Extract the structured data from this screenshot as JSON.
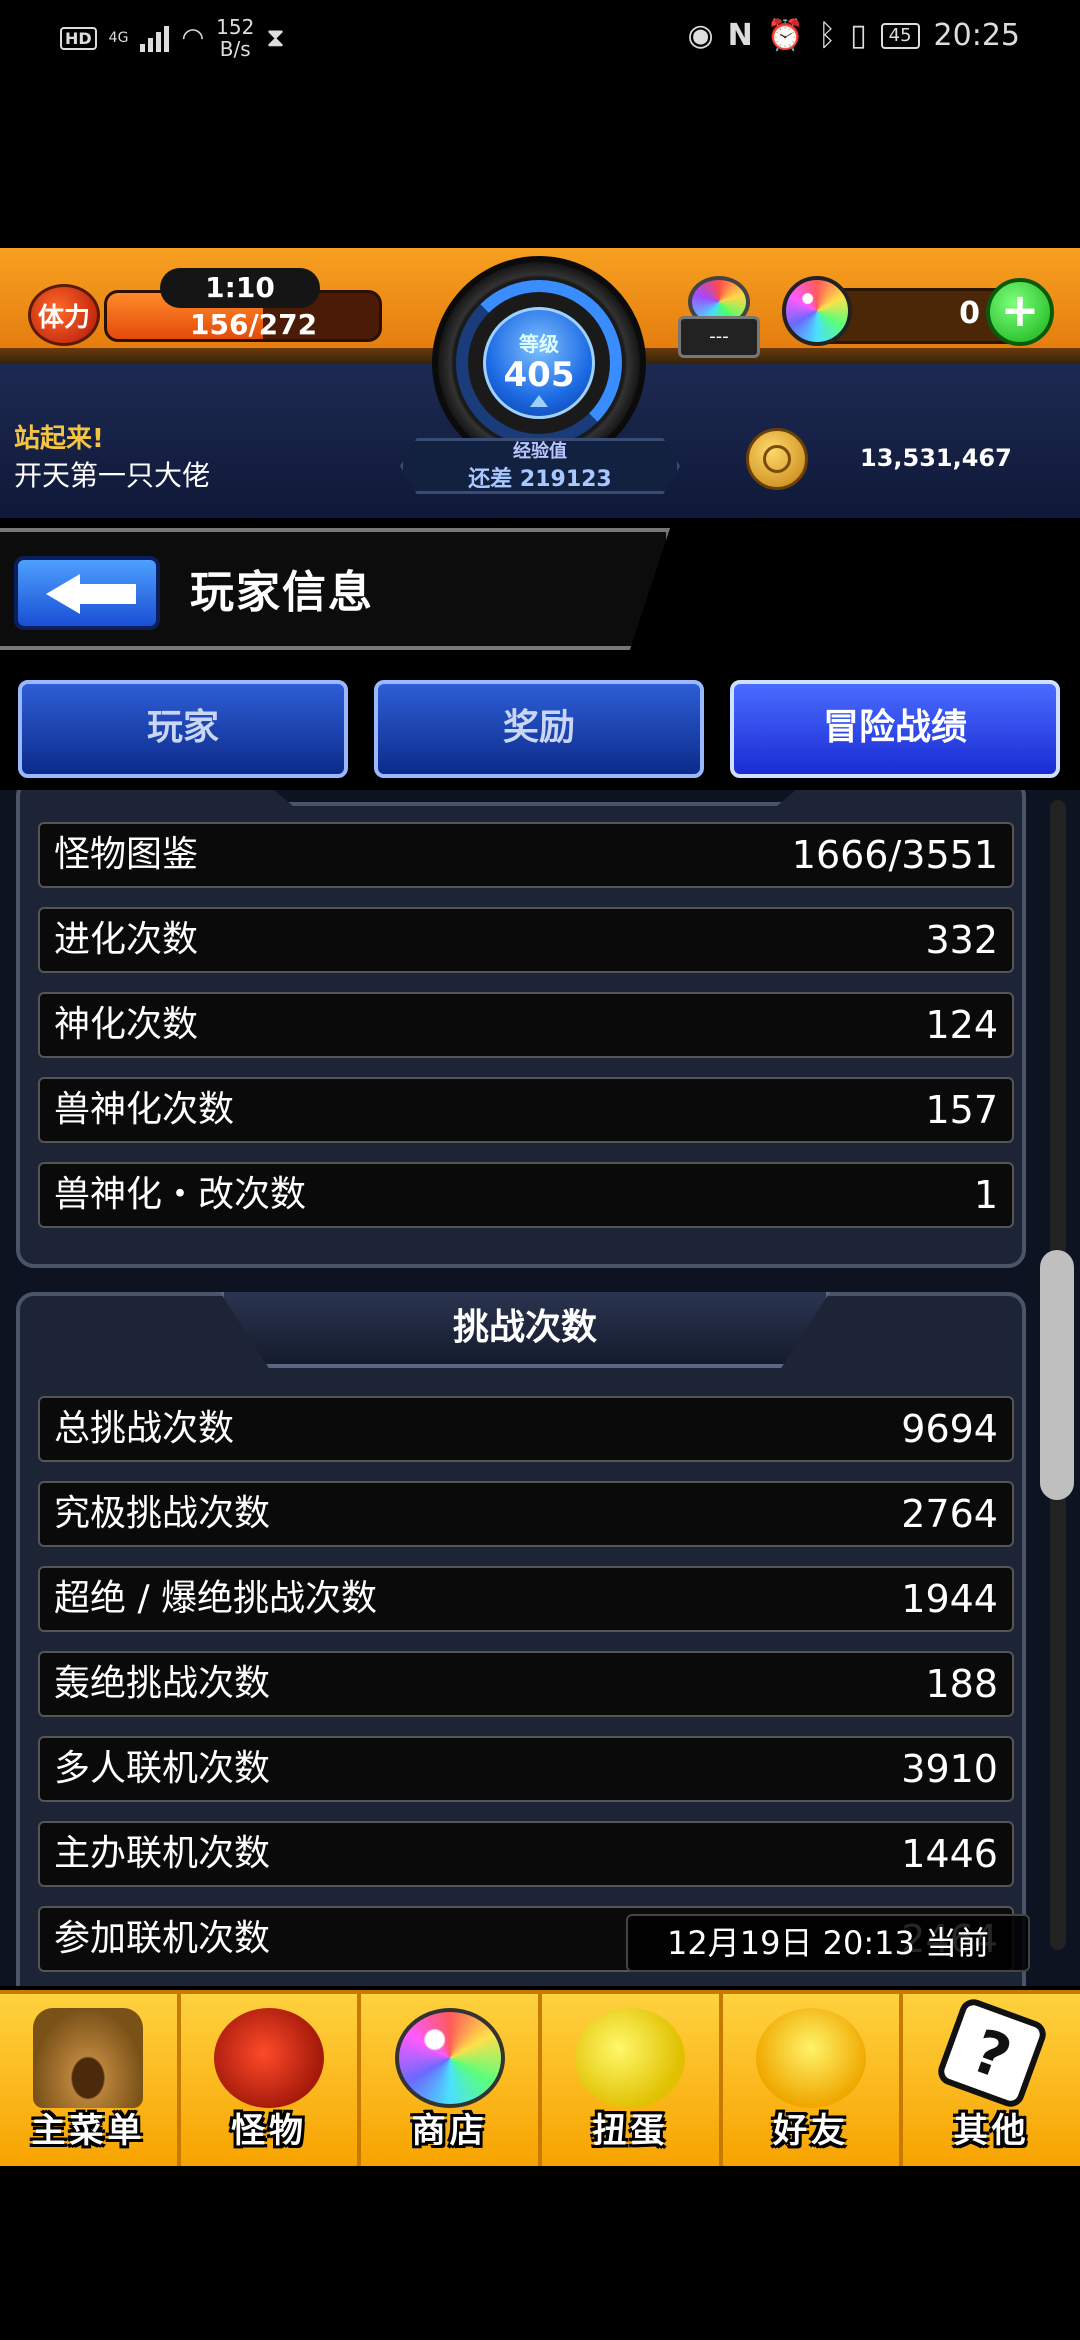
{
  "status_bar": {
    "hd": "HD",
    "network": "4G",
    "speed_value": "152",
    "speed_unit": "B/s",
    "battery": "45",
    "time": "20:25"
  },
  "hud": {
    "stamina_label": "体力",
    "stamina_timer": "1:10",
    "stamina_text": "156/272",
    "stamina_fraction": 0.574,
    "level_label": "等级",
    "level_value": "405",
    "egg_label": "---",
    "gem_count": "0",
    "gem_plus": "+",
    "greeting_line1": "站起来!",
    "greeting_line2": "开天第一只大佬",
    "exp_label": "经验值",
    "exp_text": "还差 219123",
    "coins": "13,531,467"
  },
  "header": {
    "title": "玩家信息"
  },
  "tabs": [
    {
      "label": "玩家",
      "active": false
    },
    {
      "label": "奖励",
      "active": false
    },
    {
      "label": "冒险战绩",
      "active": true
    }
  ],
  "section1": {
    "rows": [
      {
        "label": "怪物图鉴",
        "value": "1666/3551"
      },
      {
        "label": "进化次数",
        "value": "332"
      },
      {
        "label": "神化次数",
        "value": "124"
      },
      {
        "label": "兽神化次数",
        "value": "157"
      },
      {
        "label": "兽神化・改次数",
        "value": "1"
      }
    ]
  },
  "section2": {
    "title": "挑战次数",
    "rows": [
      {
        "label": "总挑战次数",
        "value": "9694"
      },
      {
        "label": "究极挑战次数",
        "value": "2764"
      },
      {
        "label": "超绝 / 爆绝挑战次数",
        "value": "1944"
      },
      {
        "label": "轰绝挑战次数",
        "value": "188"
      },
      {
        "label": "多人联机次数",
        "value": "3910"
      },
      {
        "label": "主办联机次数",
        "value": "1446"
      },
      {
        "label": "参加联机次数",
        "value": "2464"
      }
    ]
  },
  "timestamp": "12月19日 20:13 当前",
  "bottom_nav": [
    {
      "label": "主菜单",
      "icon": "gate-icon"
    },
    {
      "label": "怪物",
      "icon": "monster-icon"
    },
    {
      "label": "商店",
      "icon": "orb-icon"
    },
    {
      "label": "扭蛋",
      "icon": "egg-icon"
    },
    {
      "label": "好友",
      "icon": "friends-icon"
    },
    {
      "label": "其他",
      "icon": "question-icon"
    }
  ],
  "colors": {
    "hud_orange": "#f7a021",
    "tab_blue": "#2d5ed6",
    "nav_yellow": "#ffd23f"
  }
}
